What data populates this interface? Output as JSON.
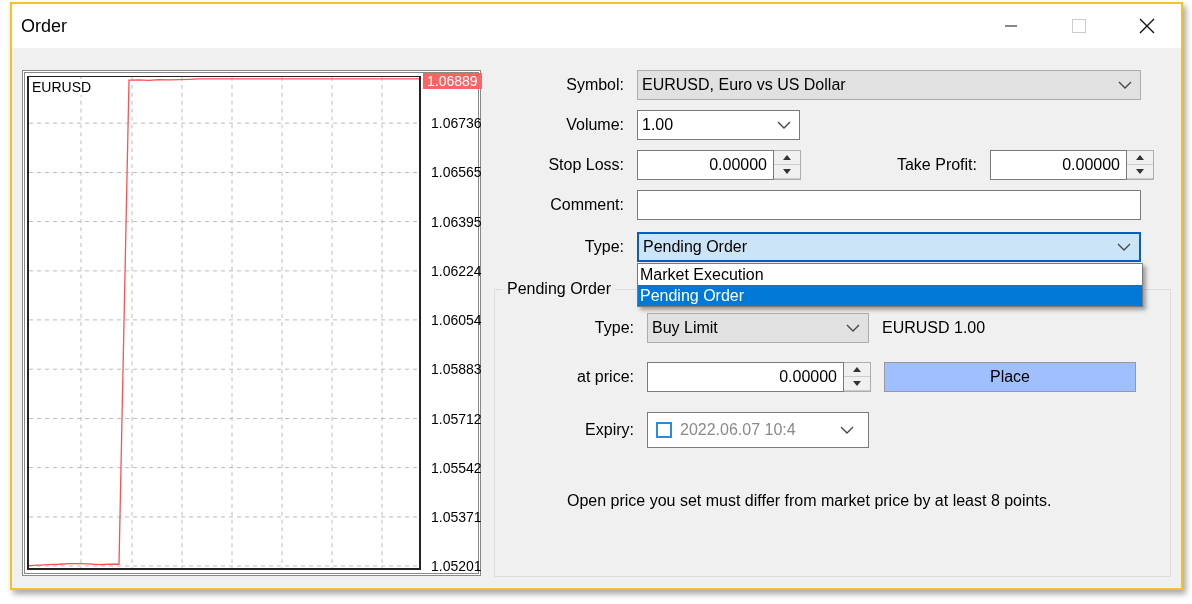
{
  "window": {
    "title": "Order",
    "controls": [
      {
        "kind": "minimize",
        "disabled": false
      },
      {
        "kind": "maximize",
        "disabled": true
      },
      {
        "kind": "close",
        "disabled": false
      }
    ]
  },
  "chart": {
    "current_price": "1.06889",
    "chart_data": {
      "type": "line",
      "ylim": [
        1.05194,
        1.06896
      ],
      "grid": true,
      "yticks": [
        {
          "value": 1.06736,
          "label": "1.06736"
        },
        {
          "value": 1.06565,
          "label": "1.06565"
        },
        {
          "value": 1.06395,
          "label": "1.06395"
        },
        {
          "value": 1.06224,
          "label": "1.06224"
        },
        {
          "value": 1.06054,
          "label": "1.06054"
        },
        {
          "value": 1.05883,
          "label": "1.05883"
        },
        {
          "value": 1.05712,
          "label": "1.05712"
        },
        {
          "value": 1.05542,
          "label": "1.05542"
        },
        {
          "value": 1.05371,
          "label": "1.05371"
        },
        {
          "value": 1.05201,
          "label": "1.05201"
        }
      ],
      "series": [
        {
          "name": "EURUSD",
          "color": "#ff5050",
          "values": [
            1.05202,
            1.05204,
            1.05206,
            1.05207,
            1.05209,
            1.05209,
            1.05208,
            1.05206,
            1.05207,
            1.05207,
            1.06885,
            1.06886,
            1.06884,
            1.06887,
            1.06886,
            1.06887,
            1.06888,
            1.06889,
            1.06889,
            1.06889,
            1.06889,
            1.06889,
            1.06889,
            1.06889,
            1.06889,
            1.06889,
            1.06889,
            1.06889,
            1.06889,
            1.06889,
            1.06889,
            1.06889,
            1.06889,
            1.06889,
            1.06889,
            1.06889,
            1.06889,
            1.06889,
            1.06889,
            1.06889
          ]
        }
      ]
    }
  },
  "form": {
    "symbol": {
      "label": "Symbol:",
      "value": "EURUSD, Euro vs US Dollar"
    },
    "volume": {
      "label": "Volume:",
      "value": "1.00"
    },
    "stop_loss": {
      "label": "Stop Loss:",
      "value": "0.00000"
    },
    "take_profit": {
      "label": "Take Profit:",
      "value": "0.00000"
    },
    "comment": {
      "label": "Comment:"
    },
    "type": {
      "label": "Type:",
      "value": "Pending Order",
      "expanded": true,
      "options": [
        {
          "label": "Market Execution",
          "selected": false
        },
        {
          "label": "Pending Order",
          "selected": true
        }
      ]
    }
  },
  "pending_order": {
    "title": "Pending Order",
    "type": {
      "label": "Type:",
      "value": "Buy Limit"
    },
    "summary": "EURUSD 1.00",
    "price": {
      "label": "at price:",
      "value": "0.00000"
    },
    "place_button": "Place",
    "expiry": {
      "label": "Expiry:",
      "checked": false,
      "value": "2022.06.07 10:4"
    },
    "note": "Open price you set must differ from market price by at least 8 points."
  }
}
